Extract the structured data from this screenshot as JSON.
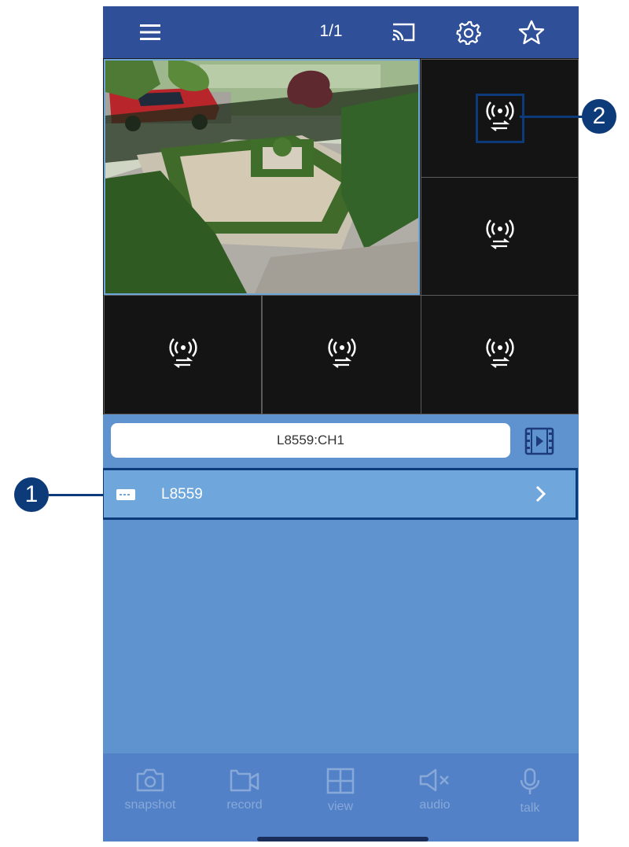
{
  "topbar": {
    "page_indicator": "1/1",
    "icons": [
      "menu-icon",
      "cast-icon",
      "settings-gear-icon",
      "favorite-star-icon"
    ]
  },
  "grid": {
    "cells": [
      {
        "type": "live-video"
      },
      {
        "type": "no-signal",
        "icon": "wireless-signal-icon"
      },
      {
        "type": "no-signal",
        "icon": "wireless-signal-icon"
      },
      {
        "type": "no-signal",
        "icon": "wireless-signal-icon"
      },
      {
        "type": "no-signal",
        "icon": "wireless-signal-icon"
      },
      {
        "type": "no-signal",
        "icon": "wireless-signal-icon"
      }
    ]
  },
  "channel": {
    "label": "L8559:CH1"
  },
  "device": {
    "name": "L8559",
    "icon": "dvr-device-icon"
  },
  "toolbar": {
    "snapshot": "snapshot",
    "record": "record",
    "view": "view",
    "audio": "audio",
    "talk": "talk"
  },
  "callouts": {
    "one": "1",
    "two": "2"
  },
  "colors": {
    "topbar": "#2f4f98",
    "panel": "#5e93cf",
    "device_row": "#6fa6dc",
    "callout": "#0d3a78",
    "grid_bg": "#141414"
  }
}
